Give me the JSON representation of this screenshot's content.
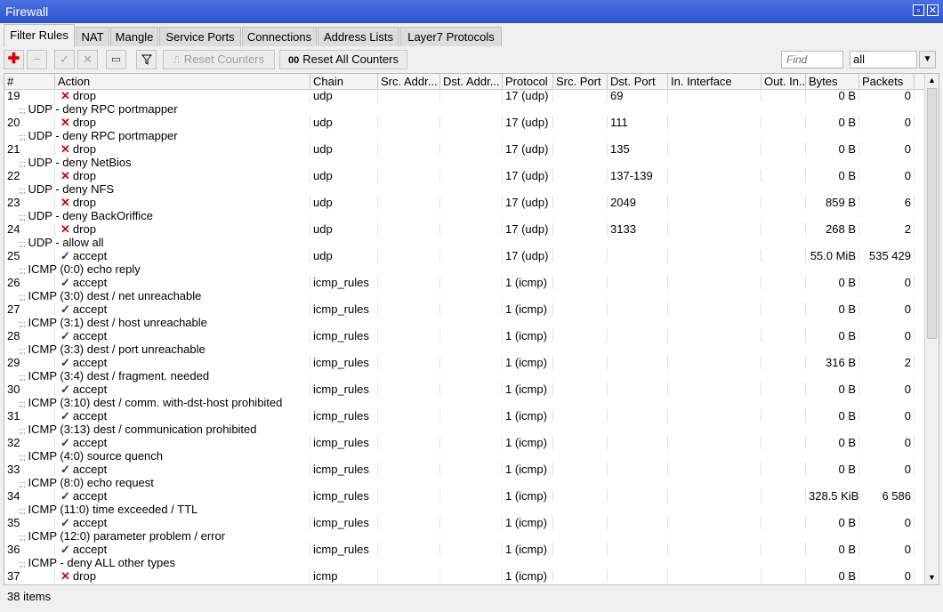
{
  "window": {
    "title": "Firewall"
  },
  "tabs": [
    "Filter Rules",
    "NAT",
    "Mangle",
    "Service Ports",
    "Connections",
    "Address Lists",
    "Layer7 Protocols"
  ],
  "toolbar": {
    "reset_counters": "Reset Counters",
    "reset_all_counters": "Reset All Counters",
    "find_placeholder": "Find",
    "filter_value": "all",
    "reset_all_icon_text": "00"
  },
  "columns": [
    "#",
    "Action",
    "Chain",
    "Src. Addr...",
    "Dst. Addr...",
    "Protocol",
    "Src. Port",
    "Dst. Port",
    "In. Interface",
    "Out. In...",
    "Bytes",
    "Packets"
  ],
  "comment_prefix": ";;;",
  "rows": [
    {
      "comment": "",
      "num": "19",
      "action": "drop",
      "chain": "udp",
      "protocol": "17 (udp)",
      "dst_port": "69",
      "bytes": "0 B",
      "packets": "0"
    },
    {
      "comment": "UDP - deny RPC portmapper",
      "num": "20",
      "action": "drop",
      "chain": "udp",
      "protocol": "17 (udp)",
      "dst_port": "111",
      "bytes": "0 B",
      "packets": "0"
    },
    {
      "comment": "UDP - deny RPC portmapper",
      "num": "21",
      "action": "drop",
      "chain": "udp",
      "protocol": "17 (udp)",
      "dst_port": "135",
      "bytes": "0 B",
      "packets": "0"
    },
    {
      "comment": "UDP - deny NetBios",
      "num": "22",
      "action": "drop",
      "chain": "udp",
      "protocol": "17 (udp)",
      "dst_port": "137-139",
      "bytes": "0 B",
      "packets": "0"
    },
    {
      "comment": "UDP - deny NFS",
      "num": "23",
      "action": "drop",
      "chain": "udp",
      "protocol": "17 (udp)",
      "dst_port": "2049",
      "bytes": "859 B",
      "packets": "6"
    },
    {
      "comment": "UDP - deny BackOriffice",
      "num": "24",
      "action": "drop",
      "chain": "udp",
      "protocol": "17 (udp)",
      "dst_port": "3133",
      "bytes": "268 B",
      "packets": "2"
    },
    {
      "comment": "UDP - allow all",
      "num": "25",
      "action": "accept",
      "chain": "udp",
      "protocol": "17 (udp)",
      "dst_port": "",
      "bytes": "55.0 MiB",
      "packets": "535 429"
    },
    {
      "comment": "ICMP (0:0) echo reply",
      "num": "26",
      "action": "accept",
      "chain": "icmp_rules",
      "protocol": "1 (icmp)",
      "dst_port": "",
      "bytes": "0 B",
      "packets": "0"
    },
    {
      "comment": "ICMP (3:0) dest / net unreachable",
      "num": "27",
      "action": "accept",
      "chain": "icmp_rules",
      "protocol": "1 (icmp)",
      "dst_port": "",
      "bytes": "0 B",
      "packets": "0"
    },
    {
      "comment": "ICMP (3:1) dest / host unreachable",
      "num": "28",
      "action": "accept",
      "chain": "icmp_rules",
      "protocol": "1 (icmp)",
      "dst_port": "",
      "bytes": "0 B",
      "packets": "0"
    },
    {
      "comment": "ICMP (3:3) dest / port unreachable",
      "num": "29",
      "action": "accept",
      "chain": "icmp_rules",
      "protocol": "1 (icmp)",
      "dst_port": "",
      "bytes": "316 B",
      "packets": "2"
    },
    {
      "comment": "ICMP (3:4) dest / fragment. needed",
      "num": "30",
      "action": "accept",
      "chain": "icmp_rules",
      "protocol": "1 (icmp)",
      "dst_port": "",
      "bytes": "0 B",
      "packets": "0"
    },
    {
      "comment": "ICMP (3:10) dest / comm. with-dst-host prohibited",
      "num": "31",
      "action": "accept",
      "chain": "icmp_rules",
      "protocol": "1 (icmp)",
      "dst_port": "",
      "bytes": "0 B",
      "packets": "0"
    },
    {
      "comment": "ICMP (3:13) dest / communication prohibited",
      "num": "32",
      "action": "accept",
      "chain": "icmp_rules",
      "protocol": "1 (icmp)",
      "dst_port": "",
      "bytes": "0 B",
      "packets": "0"
    },
    {
      "comment": "ICMP (4:0) source quench",
      "num": "33",
      "action": "accept",
      "chain": "icmp_rules",
      "protocol": "1 (icmp)",
      "dst_port": "",
      "bytes": "0 B",
      "packets": "0"
    },
    {
      "comment": "ICMP (8:0) echo request",
      "num": "34",
      "action": "accept",
      "chain": "icmp_rules",
      "protocol": "1 (icmp)",
      "dst_port": "",
      "bytes": "328.5 KiB",
      "packets": "6 586"
    },
    {
      "comment": "ICMP (11:0) time exceeded / TTL",
      "num": "35",
      "action": "accept",
      "chain": "icmp_rules",
      "protocol": "1 (icmp)",
      "dst_port": "",
      "bytes": "0 B",
      "packets": "0"
    },
    {
      "comment": "ICMP (12:0) parameter problem / error",
      "num": "36",
      "action": "accept",
      "chain": "icmp_rules",
      "protocol": "1 (icmp)",
      "dst_port": "",
      "bytes": "0 B",
      "packets": "0"
    },
    {
      "comment": "ICMP - deny ALL other types",
      "num": "37",
      "action": "drop",
      "chain": "icmp",
      "protocol": "1 (icmp)",
      "dst_port": "",
      "bytes": "0 B",
      "packets": "0"
    }
  ],
  "status": {
    "items": "38 items"
  },
  "colors": {
    "titlebar": "#2f55d4",
    "drop_icon": "#dd0000",
    "accept_icon": "#1030c0"
  }
}
